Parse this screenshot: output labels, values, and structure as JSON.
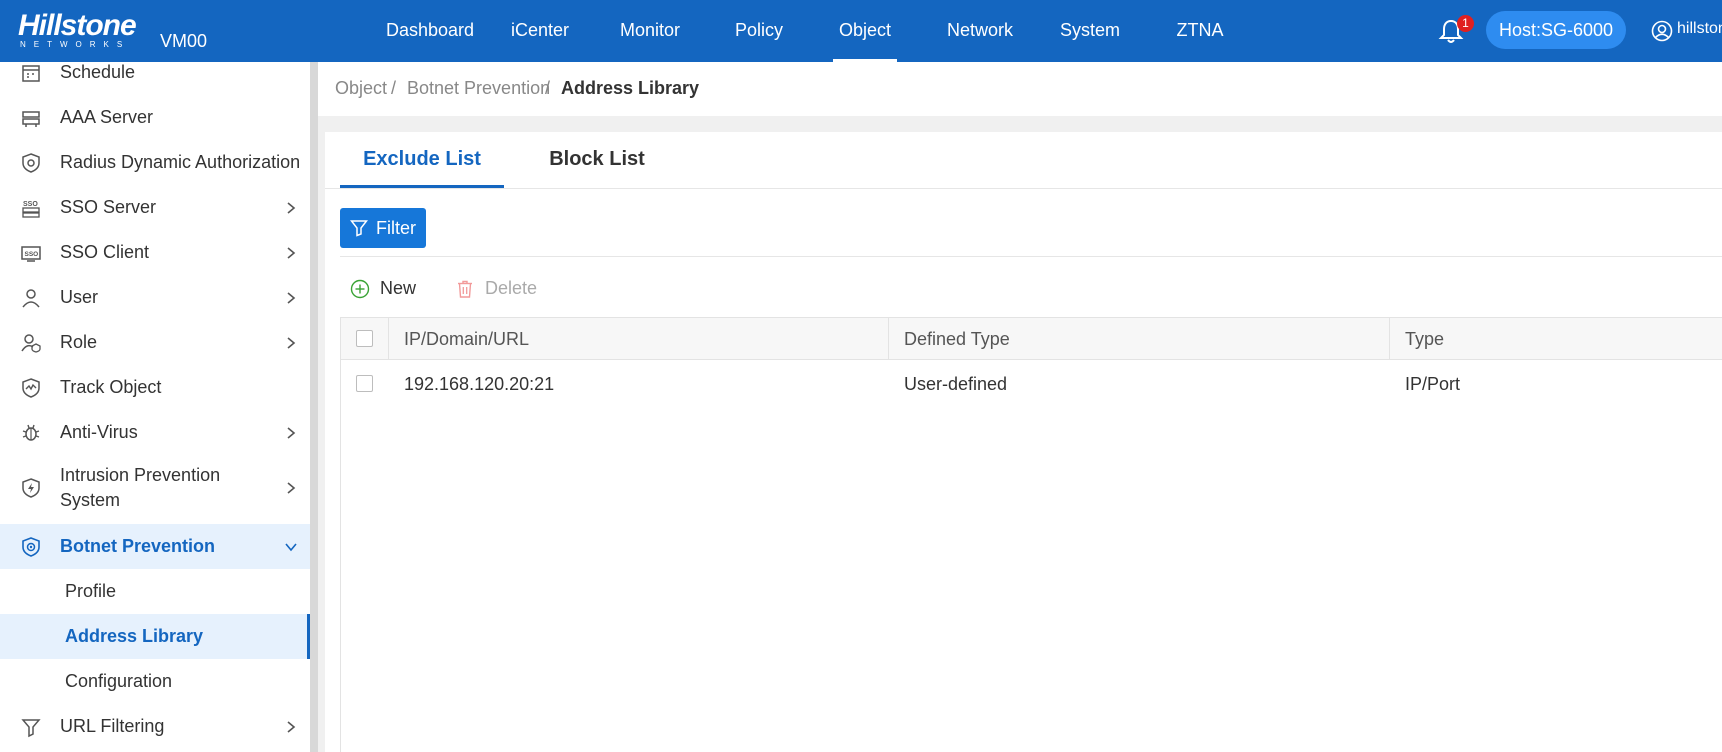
{
  "header": {
    "logo_main": "Hillstone",
    "logo_sub": "NETWORKS",
    "device": "VM00",
    "nav": [
      {
        "label": "Dashboard"
      },
      {
        "label": "iCenter"
      },
      {
        "label": "Monitor"
      },
      {
        "label": "Policy"
      },
      {
        "label": "Object",
        "active": true
      },
      {
        "label": "Network"
      },
      {
        "label": "System"
      },
      {
        "label": "ZTNA"
      }
    ],
    "notification_count": "1",
    "host": "Host:SG-6000",
    "user": "hillstone"
  },
  "sidebar": {
    "items": [
      {
        "label": "Schedule",
        "icon": "calendar-icon"
      },
      {
        "label": "AAA Server",
        "icon": "server-icon"
      },
      {
        "label": "Radius Dynamic Authorization",
        "icon": "shield-gear-icon"
      },
      {
        "label": "SSO Server",
        "icon": "sso-server-icon"
      },
      {
        "label": "SSO Client",
        "icon": "sso-client-icon"
      },
      {
        "label": "User",
        "icon": "user-icon"
      },
      {
        "label": "Role",
        "icon": "role-icon"
      },
      {
        "label": "Track Object",
        "icon": "track-icon"
      },
      {
        "label": "Anti-Virus",
        "icon": "virus-icon"
      },
      {
        "label": "Intrusion Prevention",
        "label2": "System",
        "icon": "ips-shield-icon"
      },
      {
        "label": "Botnet Prevention",
        "icon": "botnet-shield-icon"
      },
      {
        "label": "URL Filtering",
        "icon": "filter-funnel-icon"
      }
    ],
    "sub_items": [
      {
        "label": "Profile"
      },
      {
        "label": "Address Library"
      },
      {
        "label": "Configuration"
      }
    ]
  },
  "breadcrumb": {
    "part1": "Object",
    "sep": "/",
    "part2": "Botnet Prevention",
    "current": "Address Library"
  },
  "tabs": [
    {
      "label": "Exclude List",
      "active": true
    },
    {
      "label": "Block List"
    }
  ],
  "toolbar": {
    "filter": "Filter",
    "new": "New",
    "delete": "Delete"
  },
  "table": {
    "columns": [
      "IP/Domain/URL",
      "Defined Type",
      "Type"
    ],
    "rows": [
      [
        "192.168.120.20:21",
        "User-defined",
        "IP/Port"
      ]
    ]
  },
  "colors": {
    "brand": "#1466c0",
    "accent": "#1677d9",
    "badge": "#e02020"
  }
}
